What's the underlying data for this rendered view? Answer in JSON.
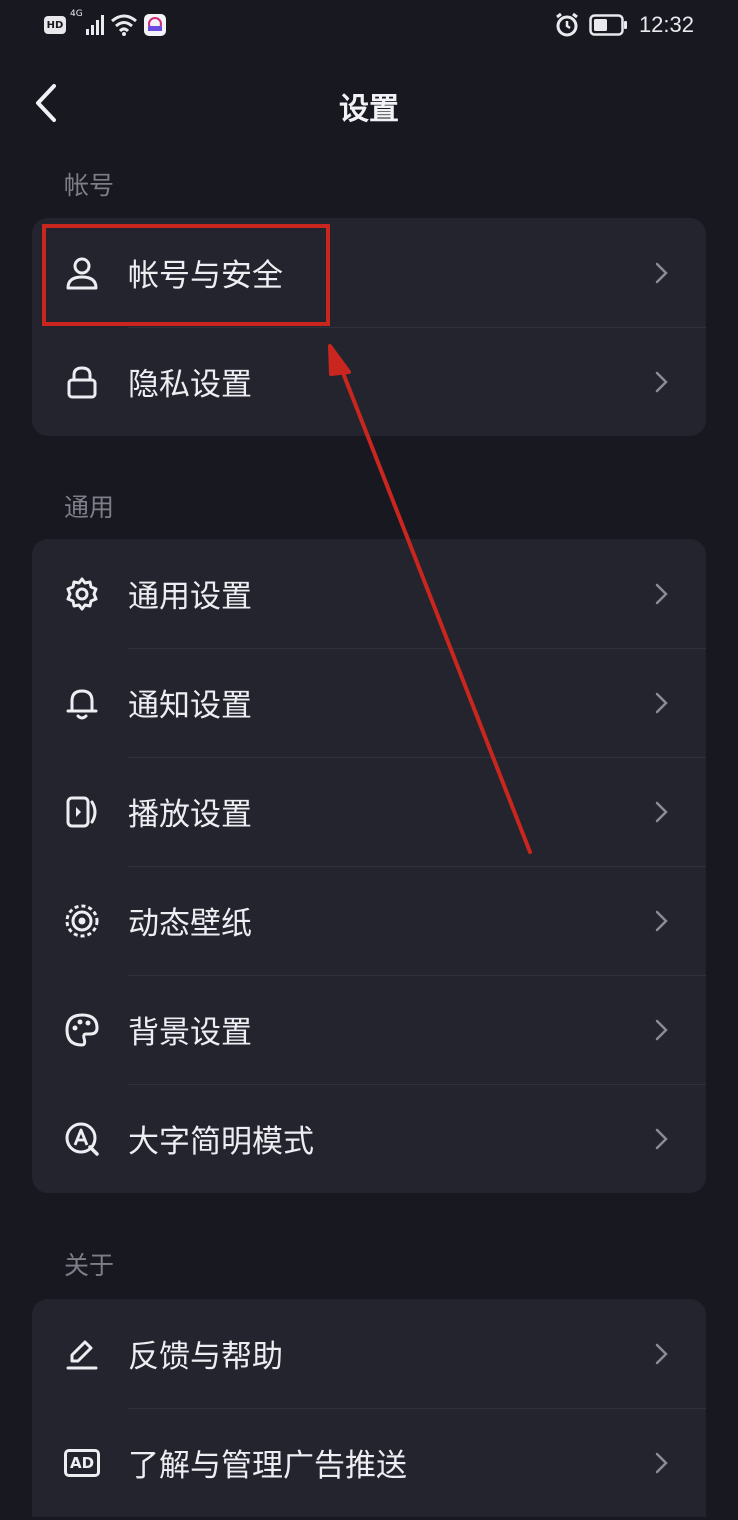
{
  "status_bar": {
    "hd_badge": "HD",
    "network": "4G",
    "time": "12:32"
  },
  "nav": {
    "title": "设置"
  },
  "sections": {
    "account": {
      "label": "帐号",
      "items": [
        {
          "label": "帐号与安全",
          "icon": "person-icon"
        },
        {
          "label": "隐私设置",
          "icon": "lock-icon"
        }
      ]
    },
    "general": {
      "label": "通用",
      "items": [
        {
          "label": "通用设置",
          "icon": "gear-icon"
        },
        {
          "label": "通知设置",
          "icon": "bell-icon"
        },
        {
          "label": "播放设置",
          "icon": "play-screen-icon"
        },
        {
          "label": "动态壁纸",
          "icon": "wallpaper-ring-icon"
        },
        {
          "label": "背景设置",
          "icon": "palette-icon"
        },
        {
          "label": "大字简明模式",
          "icon": "large-font-icon"
        }
      ]
    },
    "about": {
      "label": "关于",
      "items": [
        {
          "label": "反馈与帮助",
          "icon": "pencil-icon"
        },
        {
          "label": "了解与管理广告推送",
          "icon": "ad-icon"
        }
      ]
    }
  },
  "ad_icon_text": "AD",
  "colors": {
    "background": "#171820",
    "card": "#23242d",
    "divider": "#30313b",
    "text": "#ededf2",
    "section_label": "#7d7e88",
    "annotation": "#c8261e"
  }
}
